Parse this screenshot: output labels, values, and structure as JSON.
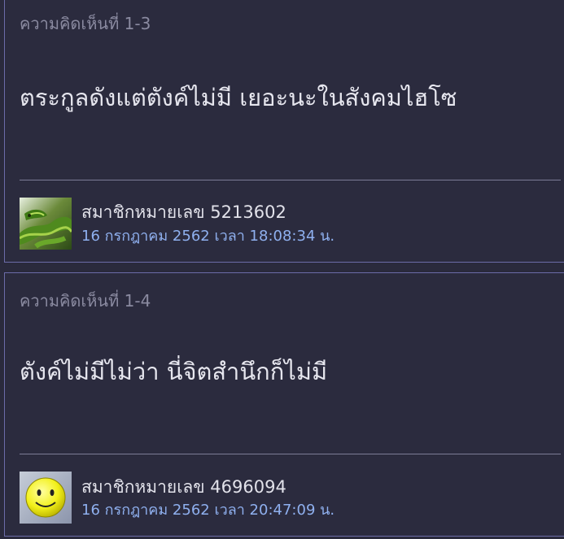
{
  "colors": {
    "background": "#2a2a3c",
    "card_border": "#6c6ca8",
    "header_text": "#8a8aa0",
    "body_text": "#e6e6ee",
    "timestamp_text": "#8fb0ef"
  },
  "comments": [
    {
      "header": "ความคิดเห็นที่ 1-3",
      "body": "ตระกูลดังแต่ตังค์ไม่มี เยอะนะในสังคมไฮโซ",
      "user": "สมาชิกหมายเลข 5213602",
      "timestamp": "16 กรกฎาคม 2562 เวลา 18:08:34 น.",
      "avatar_icon": "green-snake-avatar"
    },
    {
      "header": "ความคิดเห็นที่ 1-4",
      "body": "ตังค์ไม่มีไม่ว่า นี่จิตสำนึกก็ไม่มี",
      "user": "สมาชิกหมายเลข 4696094",
      "timestamp": "16 กรกฎาคม 2562 เวลา 20:47:09 น.",
      "avatar_icon": "smiley-face-avatar"
    }
  ]
}
